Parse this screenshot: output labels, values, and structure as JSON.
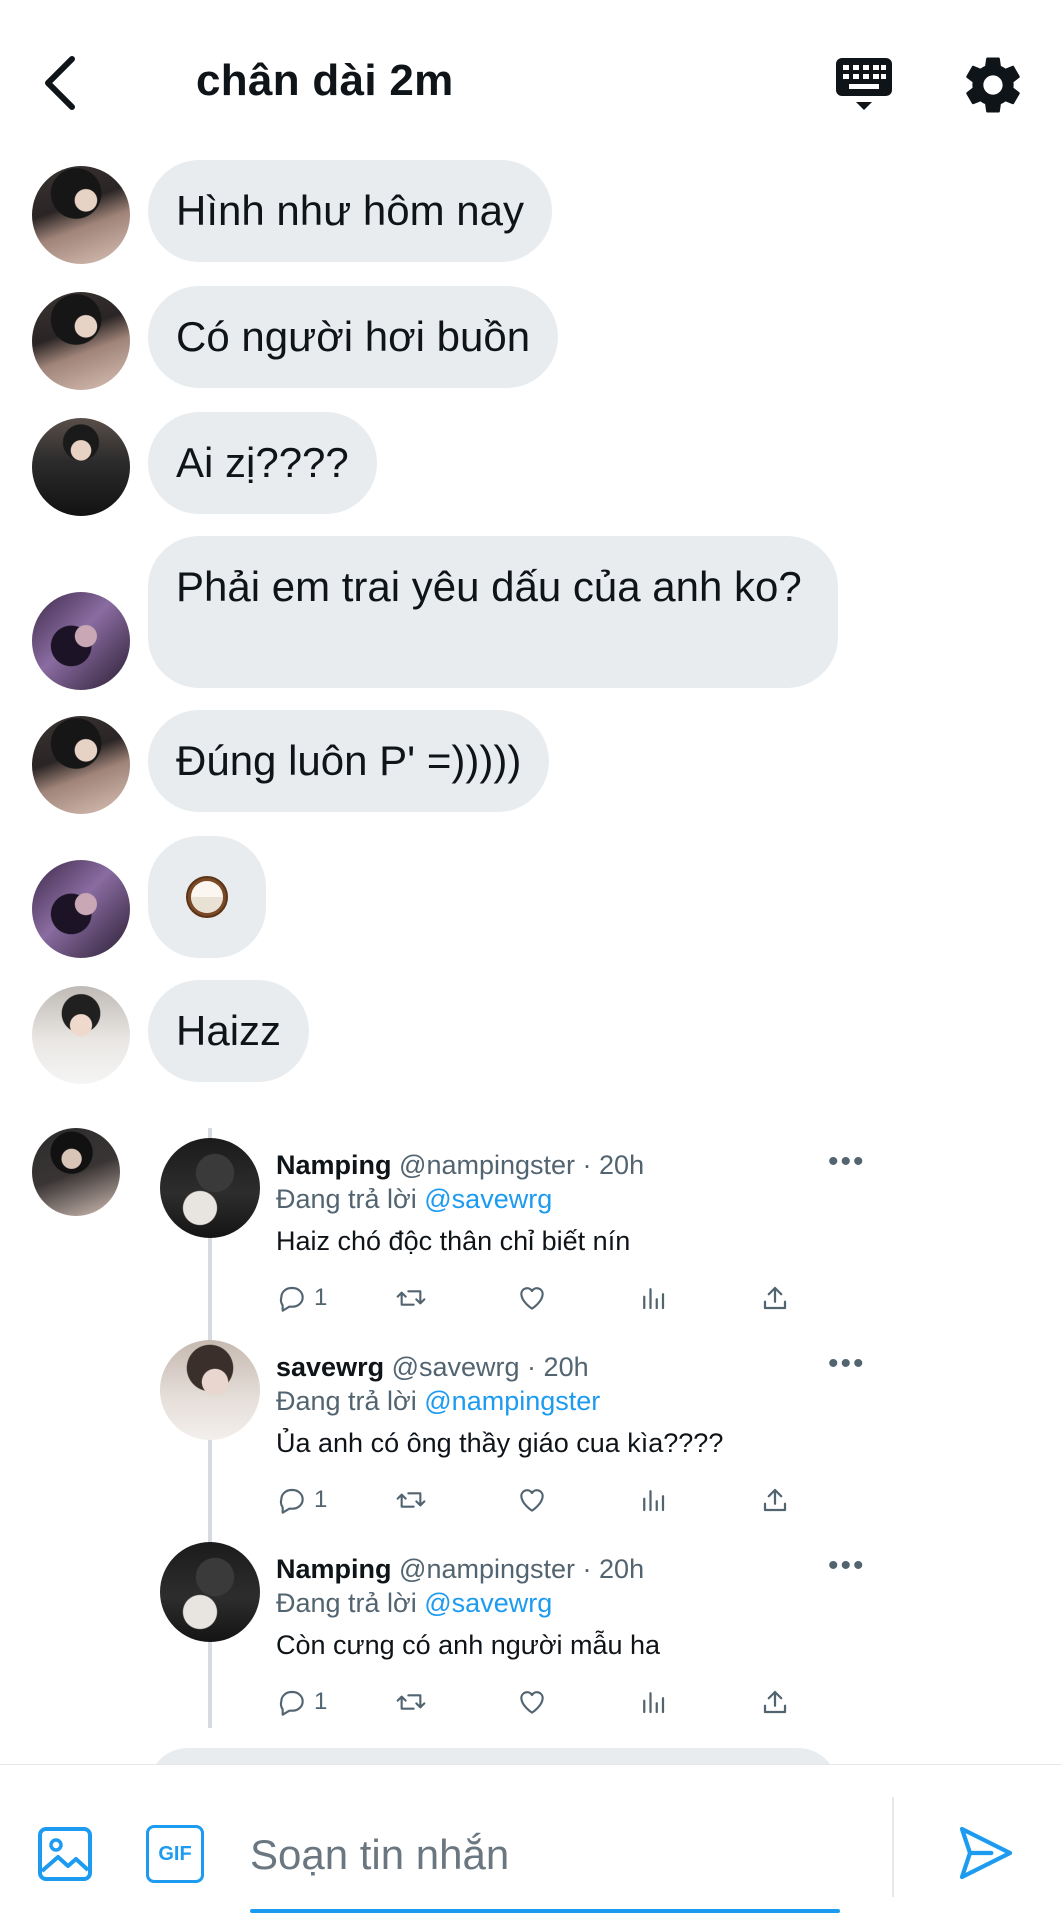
{
  "header": {
    "title": "chân dài 2m",
    "back_icon": "chevron-left-icon",
    "keyboard_icon": "keyboard-icon",
    "settings_icon": "gear-icon"
  },
  "messages": [
    {
      "text": "Hình như hôm nay"
    },
    {
      "text": "Có người hơi buồn"
    },
    {
      "text": "Ai zị????"
    },
    {
      "text": "Phải em trai yêu dấu của anh ko?"
    },
    {
      "text": "Đúng luôn P' =)))))"
    },
    {
      "emoji": "coconut-icon"
    },
    {
      "text": "Haizz"
    }
  ],
  "tweets": [
    {
      "name": "Namping",
      "handle": "@nampingster",
      "sep": " · ",
      "time": "20h",
      "reply_prefix": "Đang trả lời ",
      "reply_to": "@savewrg",
      "text": "Haiz chó độc thân chỉ biết nín",
      "reply_count": "1"
    },
    {
      "name": "savewrg",
      "handle": "@savewrg",
      "sep": " · ",
      "time": "20h",
      "reply_prefix": "Đang trả lời ",
      "reply_to": "@nampingster",
      "text": "Ủa anh có ông thầy giáo cua kìa????",
      "reply_count": "1"
    },
    {
      "name": "Namping",
      "handle": "@nampingster",
      "sep": " · ",
      "time": "20h",
      "reply_prefix": "Đang trả lời ",
      "reply_to": "@savewrg",
      "text": "Còn cưng có anh người mẫu ha",
      "reply_count": "1"
    }
  ],
  "composer": {
    "placeholder": "Soạn tin nhắn",
    "gif_label": "GIF",
    "image_icon": "image-icon",
    "send_icon": "send-icon"
  },
  "colors": {
    "accent": "#1d9bf0",
    "bubble": "#e9ecef",
    "text": "#0f1419",
    "muted": "#536471"
  }
}
